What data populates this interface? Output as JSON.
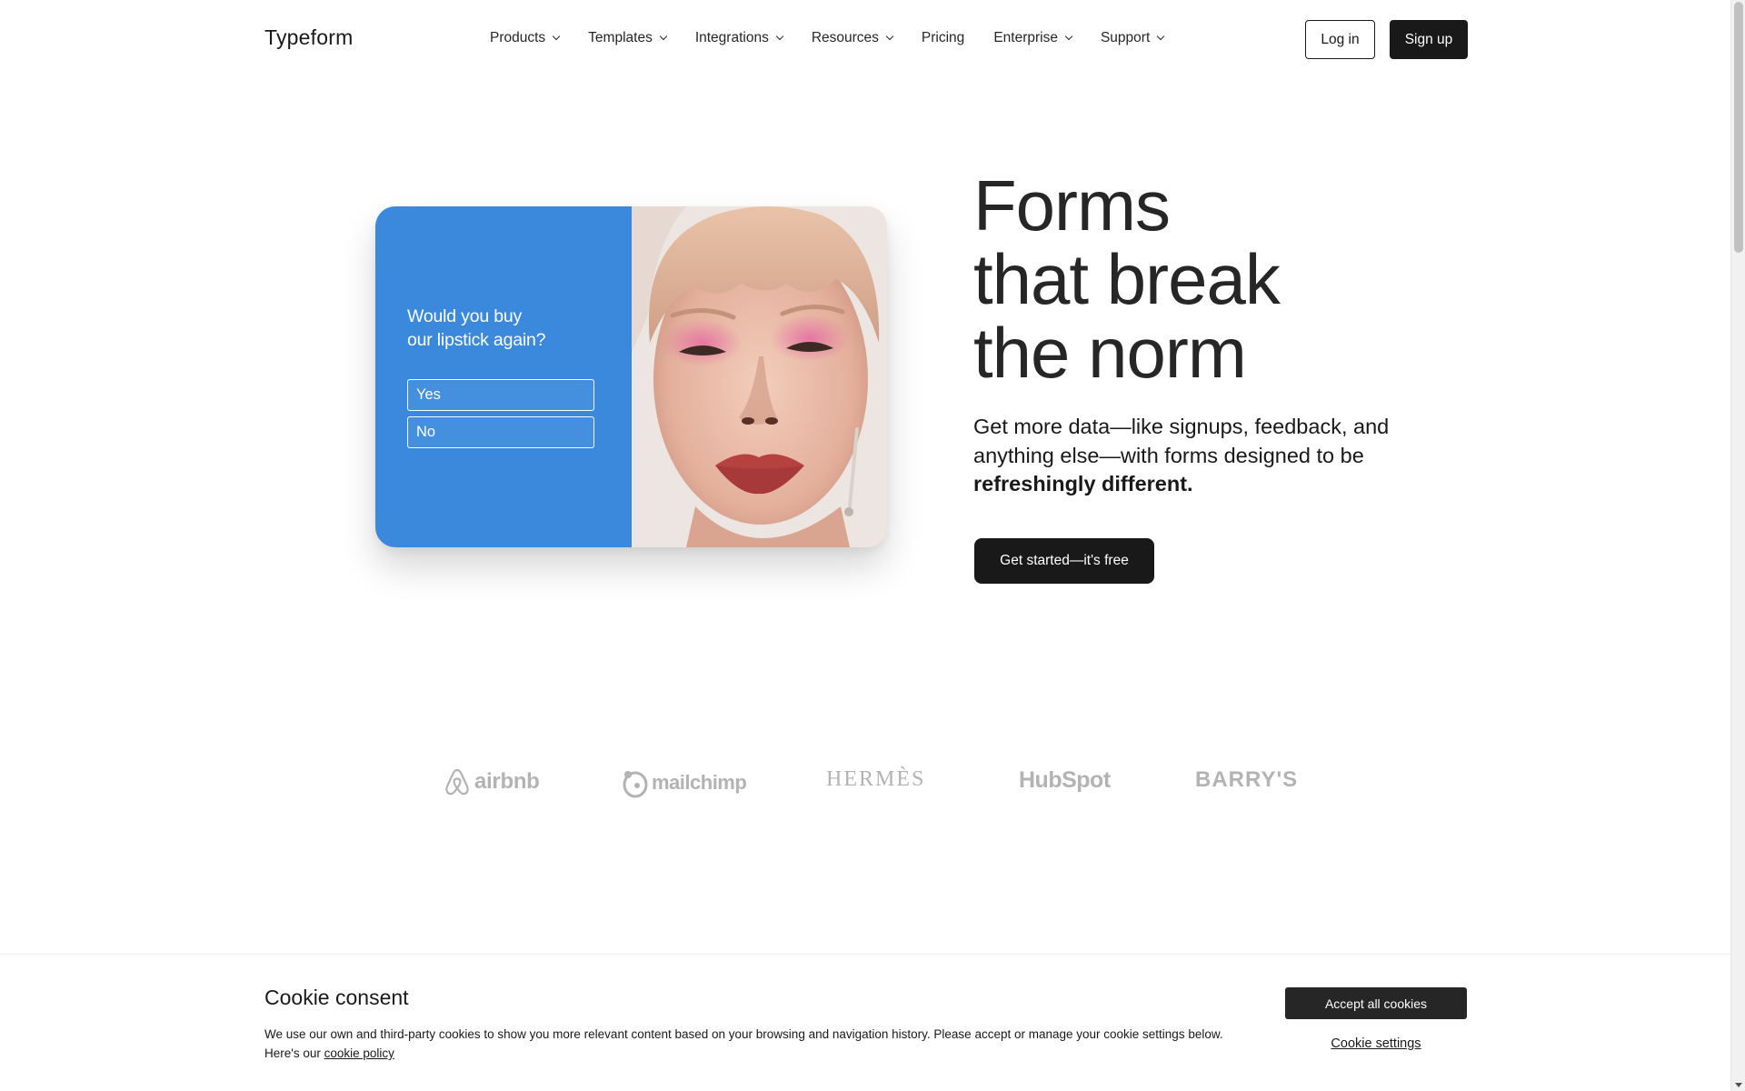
{
  "header": {
    "logo": "Typeform",
    "nav": [
      {
        "label": "Products",
        "has_dropdown": true
      },
      {
        "label": "Templates",
        "has_dropdown": true
      },
      {
        "label": "Integrations",
        "has_dropdown": true
      },
      {
        "label": "Resources",
        "has_dropdown": true
      },
      {
        "label": "Pricing",
        "has_dropdown": false
      },
      {
        "label": "Enterprise",
        "has_dropdown": true
      },
      {
        "label": "Support",
        "has_dropdown": true
      }
    ],
    "login_label": "Log in",
    "signup_label": "Sign up"
  },
  "hero": {
    "card": {
      "question_line1": "Would you buy",
      "question_line2": "our lipstick again?",
      "options": [
        "Yes",
        "No"
      ],
      "accent_color": "#3a89dd"
    },
    "title_line1": "Forms",
    "title_line2": "that break",
    "title_line3": "the norm",
    "subtitle_plain": "Get more data—like signups, feedback, and anything else—with forms designed to be",
    "subtitle_bold": "refreshingly different.",
    "cta_label": "Get started—it's free"
  },
  "logos": {
    "airbnb": "airbnb",
    "mailchimp": "mailchimp",
    "hermes": "HERMÈS",
    "hubspot": "HubSpot",
    "barrys": "BARRY'S"
  },
  "cookie": {
    "title": "Cookie consent",
    "text": "We use our own and third-party cookies to show you more relevant content based on your browsing and navigation history. Please accept or manage your cookie settings below. Here's our",
    "link_label": "cookie policy",
    "accept_label": "Accept all cookies",
    "settings_label": "Cookie settings"
  }
}
